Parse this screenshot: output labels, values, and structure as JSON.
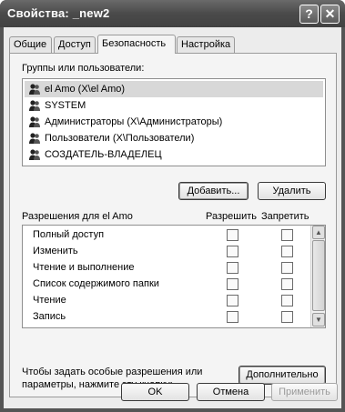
{
  "window": {
    "title": "Свойства: _new2",
    "help_glyph": "?",
    "close_glyph": "✕"
  },
  "tabs": [
    {
      "label": "Общие",
      "active": false
    },
    {
      "label": "Доступ",
      "active": false
    },
    {
      "label": "Безопасность",
      "active": true
    },
    {
      "label": "Настройка",
      "active": false
    }
  ],
  "groups": {
    "label": "Группы или пользователи:",
    "items": [
      {
        "name": "el Amo (X\\el Amo)",
        "selected": true
      },
      {
        "name": "SYSTEM",
        "selected": false
      },
      {
        "name": "Администраторы (X\\Администраторы)",
        "selected": false
      },
      {
        "name": "Пользователи (X\\Пользователи)",
        "selected": false
      },
      {
        "name": "СОЗДАТЕЛЬ-ВЛАДЕЛЕЦ",
        "selected": false
      }
    ],
    "add_label": "Добавить...",
    "remove_label": "Удалить"
  },
  "permissions": {
    "title": "Разрешения для el Amo",
    "allow_header": "Разрешить",
    "deny_header": "Запретить",
    "items": [
      {
        "name": "Полный доступ",
        "allow": false,
        "deny": false
      },
      {
        "name": "Изменить",
        "allow": false,
        "deny": false
      },
      {
        "name": "Чтение и выполнение",
        "allow": false,
        "deny": false
      },
      {
        "name": "Список содержимого папки",
        "allow": false,
        "deny": false
      },
      {
        "name": "Чтение",
        "allow": false,
        "deny": false
      },
      {
        "name": "Запись",
        "allow": false,
        "deny": false
      }
    ]
  },
  "advanced": {
    "hint": "Чтобы задать особые разрешения или параметры, нажмите эту кнопку:",
    "button_label": "Дополнительно"
  },
  "footer": {
    "ok_label": "OK",
    "cancel_label": "Отмена",
    "apply_label": "Применить"
  }
}
